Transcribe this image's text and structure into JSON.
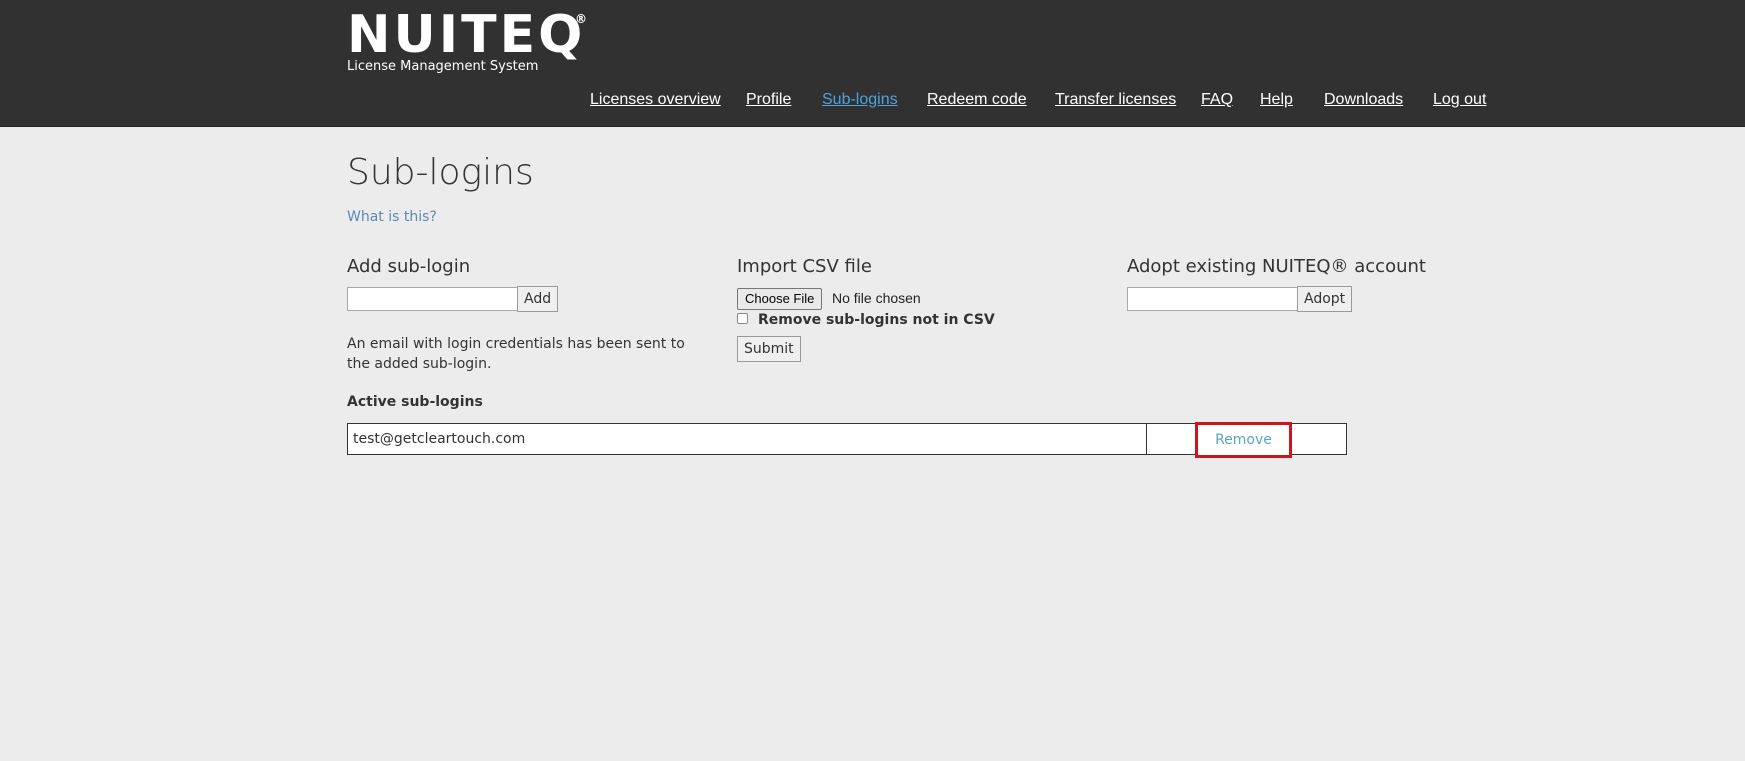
{
  "header": {
    "logo": "NUITEQ",
    "logo_mark": "®",
    "subtitle": "License Management System"
  },
  "nav": {
    "items": [
      {
        "label": "Licenses overview",
        "active": false
      },
      {
        "label": "Profile",
        "active": false
      },
      {
        "label": "Sub-logins",
        "active": true
      },
      {
        "label": "Redeem code",
        "active": false
      },
      {
        "label": "Transfer licenses",
        "active": false
      },
      {
        "label": "FAQ",
        "active": false
      },
      {
        "label": "Help",
        "active": false
      },
      {
        "label": "Downloads",
        "active": false
      },
      {
        "label": "Log out",
        "active": false
      }
    ]
  },
  "page": {
    "title": "Sub-logins",
    "what_link": "What is this?"
  },
  "add_sublogin": {
    "title": "Add sub-login",
    "input_value": "",
    "button": "Add",
    "message": "An email with login credentials has been sent to the added sub-login."
  },
  "import_csv": {
    "title": "Import CSV file",
    "choose_button": "Choose File",
    "file_status": "No file chosen",
    "checkbox_label": "Remove sub-logins not in CSV",
    "checkbox_checked": false,
    "submit": "Submit"
  },
  "adopt": {
    "title": "Adopt existing NUITEQ® account",
    "input_value": "",
    "button": "Adopt"
  },
  "active_sublogins": {
    "label": "Active sub-logins",
    "rows": [
      {
        "email": "test@getcleartouch.com",
        "action": "Remove"
      }
    ]
  },
  "colors": {
    "header_bg": "#313131",
    "page_bg": "#ececec",
    "active_nav": "#4fa3dc",
    "link": "#5aa6c3",
    "highlight": "#d4141c"
  }
}
